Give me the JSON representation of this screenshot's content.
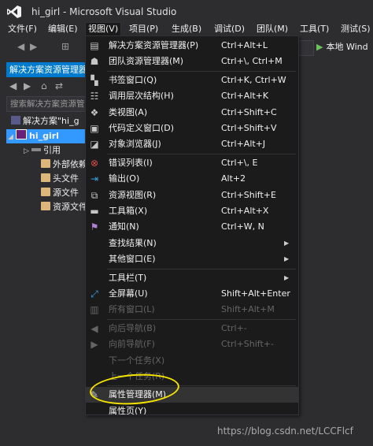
{
  "title": "hi_girl - Microsoft Visual Studio",
  "menubar": [
    "文件(F)",
    "编辑(E)",
    "视图(V)",
    "项目(P)",
    "生成(B)",
    "调试(D)",
    "团队(M)",
    "工具(T)",
    "测试(S)"
  ],
  "toolbar": {
    "run_label": "本地 Wind"
  },
  "solution_explorer": {
    "title": "解决方案资源管理器",
    "search_placeholder": "搜索解决方案资源管",
    "tree": [
      {
        "label": "解决方案\"hi_g",
        "indent": 0
      },
      {
        "label": "hi_girl",
        "indent": 1,
        "selected": true
      },
      {
        "label": "引用",
        "indent": 2
      },
      {
        "label": "外部依赖",
        "indent": 3
      },
      {
        "label": "头文件",
        "indent": 3
      },
      {
        "label": "源文件",
        "indent": 3
      },
      {
        "label": "资源文件",
        "indent": 3
      }
    ]
  },
  "view_menu": {
    "items": [
      {
        "icon": "solution-explorer-icon",
        "label": "解决方案资源管理器(P)",
        "shortcut": "Ctrl+Alt+L"
      },
      {
        "icon": "team-explorer-icon",
        "label": "团队资源管理器(M)",
        "shortcut": "Ctrl+\\, Ctrl+M"
      },
      {
        "icon": "bookmark-icon",
        "label": "书签窗口(Q)",
        "shortcut": "Ctrl+K, Ctrl+W",
        "sep_before": true
      },
      {
        "icon": "call-hierarchy-icon",
        "label": "调用层次结构(H)",
        "shortcut": "Ctrl+Alt+K"
      },
      {
        "icon": "class-view-icon",
        "label": "类视图(A)",
        "shortcut": "Ctrl+Shift+C"
      },
      {
        "icon": "code-definition-icon",
        "label": "代码定义窗口(D)",
        "shortcut": "Ctrl+Shift+V"
      },
      {
        "icon": "object-browser-icon",
        "label": "对象浏览器(J)",
        "shortcut": "Ctrl+Alt+J"
      },
      {
        "icon": "error-list-icon",
        "label": "错误列表(I)",
        "shortcut": "Ctrl+\\, E",
        "sep_before": true
      },
      {
        "icon": "output-icon",
        "label": "输出(O)",
        "shortcut": "Alt+2"
      },
      {
        "icon": "resource-view-icon",
        "label": "资源视图(R)",
        "shortcut": "Ctrl+Shift+E"
      },
      {
        "icon": "toolbox-icon",
        "label": "工具箱(X)",
        "shortcut": "Ctrl+Alt+X"
      },
      {
        "icon": "notification-icon",
        "label": "通知(N)",
        "shortcut": "Ctrl+W, N"
      },
      {
        "icon": "",
        "label": "查找结果(N)",
        "shortcut": "",
        "submenu": true
      },
      {
        "icon": "",
        "label": "其他窗口(E)",
        "shortcut": "",
        "submenu": true
      },
      {
        "icon": "",
        "label": "工具栏(T)",
        "shortcut": "",
        "submenu": true,
        "sep_before": true
      },
      {
        "icon": "full-screen-icon",
        "label": "全屏幕(U)",
        "shortcut": "Shift+Alt+Enter"
      },
      {
        "icon": "all-windows-icon",
        "label": "所有窗口(L)",
        "shortcut": "Shift+Alt+M",
        "disabled": true
      },
      {
        "icon": "navigate-back-icon",
        "label": "向后导航(B)",
        "shortcut": "Ctrl+-",
        "disabled": true,
        "sep_before": true
      },
      {
        "icon": "navigate-forward-icon",
        "label": "向前导航(F)",
        "shortcut": "Ctrl+Shift+-",
        "disabled": true
      },
      {
        "icon": "",
        "label": "下一个任务(X)",
        "shortcut": "",
        "disabled": true
      },
      {
        "icon": "",
        "label": "上一个任务(R)",
        "shortcut": "",
        "disabled": true
      },
      {
        "icon": "property-manager-icon",
        "label": "属性管理器(M)",
        "shortcut": "",
        "highlighted": true,
        "sep_before": true
      },
      {
        "icon": "",
        "label": "属性页(Y)",
        "shortcut": ""
      }
    ]
  },
  "watermark": "https://blog.csdn.net/LCCFlcf",
  "colors": {
    "accent": "#007acc",
    "selection": "#3399ff",
    "annotation": "#f5e400"
  }
}
